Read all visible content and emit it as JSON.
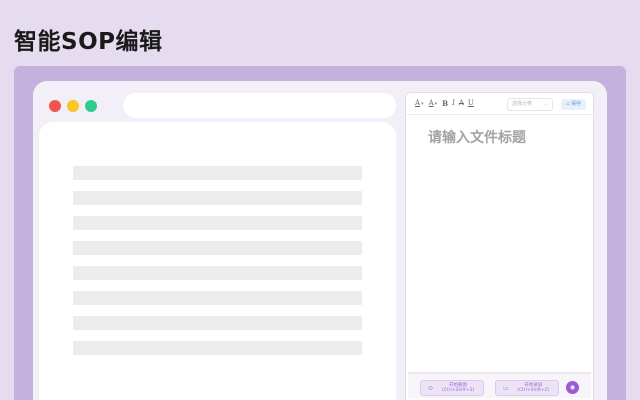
{
  "page": {
    "title": "智能SOP编辑"
  },
  "editor": {
    "toolbar": {
      "font_color_icon": "A",
      "bg_color_icon": "A",
      "bold_icon": "B",
      "italic_icon": "I",
      "strike_icon": "A",
      "underline_icon": "U",
      "category_placeholder": "选择分类",
      "save_label": "保存"
    },
    "title_placeholder": "请输入文件标题",
    "actions": {
      "screenshot_label": "开始截图",
      "screenshot_shortcut": "(Ctrl+Shift+S)",
      "record_label": "开始录屏",
      "record_shortcut": "(Ctrl+Shift+Z)"
    }
  },
  "colors": {
    "background": "#e6dcef",
    "panel": "#c4b1dc",
    "accent": "#9b5ad8",
    "window_close": "#f0554e",
    "window_minimize": "#f8c524",
    "window_maximize": "#2ecc8f"
  },
  "icons": {
    "screenshot": "camera-icon",
    "record": "video-icon",
    "assistant": "assistant-icon"
  }
}
